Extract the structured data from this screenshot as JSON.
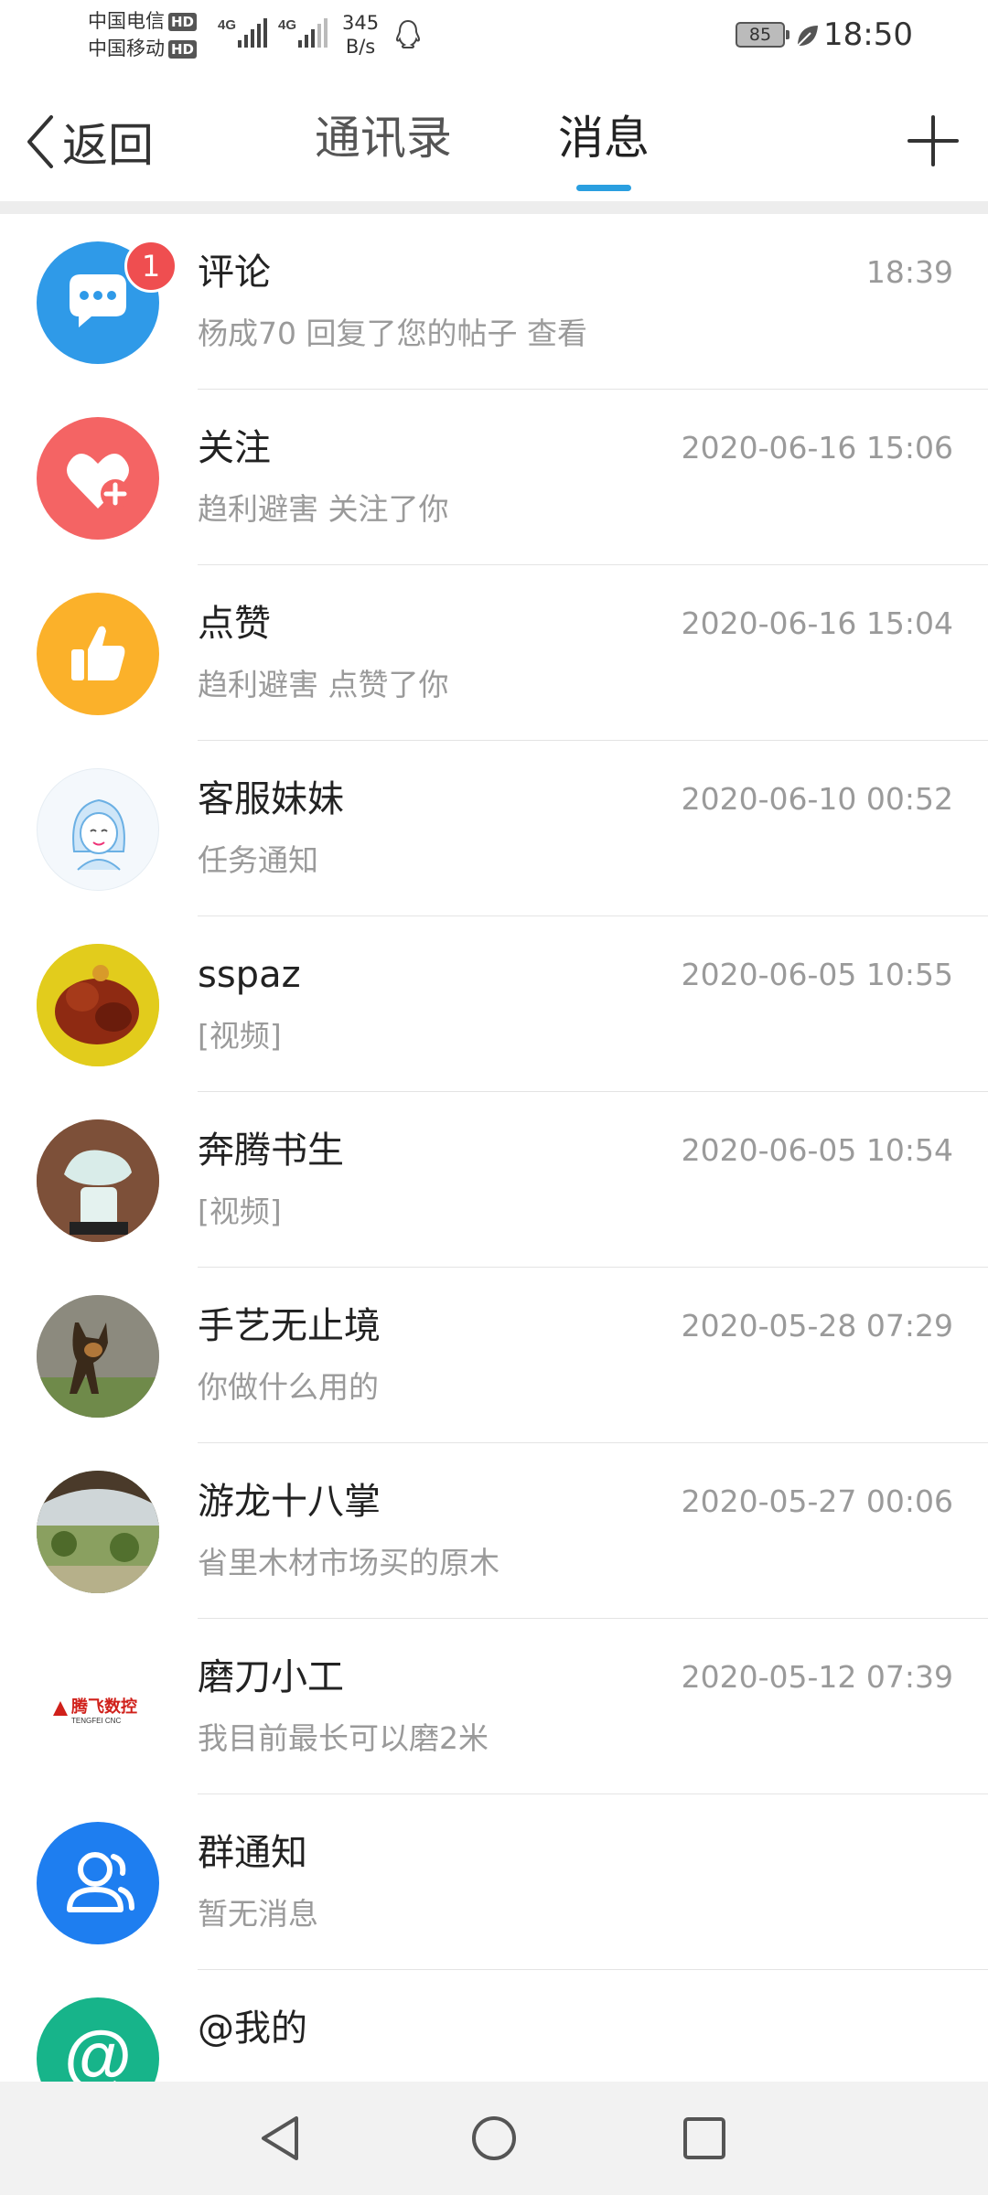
{
  "status_bar": {
    "carrier1": "中国电信",
    "carrier2": "中国移动",
    "hd": "HD",
    "net1": "4G",
    "net2": "4G",
    "speed_value": "345",
    "speed_unit": "B/s",
    "battery": "85",
    "time": "18:50"
  },
  "header": {
    "back_label": "返回",
    "tabs": [
      {
        "label": "通讯录",
        "active": false
      },
      {
        "label": "消息",
        "active": true
      }
    ],
    "accent_color": "#2a9fe0"
  },
  "messages": [
    {
      "title": "评论",
      "time": "18:39",
      "subtitle": "杨成70 回复了您的帖子   查看",
      "badge": "1",
      "avatar": "comment-icon",
      "color": "#2f9ae8"
    },
    {
      "title": "关注",
      "time": "2020-06-16 15:06",
      "subtitle": "趋利避害 关注了你",
      "avatar": "heart-plus-icon",
      "color": "#f46464"
    },
    {
      "title": "点赞",
      "time": "2020-06-16 15:04",
      "subtitle": "趋利避害 点赞了你",
      "avatar": "thumbs-up-icon",
      "color": "#fbb12a"
    },
    {
      "title": "客服妹妹",
      "time": "2020-06-10 00:52",
      "subtitle": "任务通知",
      "avatar": "customer-service-avatar"
    },
    {
      "title": "sspaz",
      "time": "2020-06-05 10:55",
      "subtitle": "[视频]",
      "avatar": "carving-photo-avatar"
    },
    {
      "title": "奔腾书生",
      "time": "2020-06-05 10:54",
      "subtitle": "[视频]",
      "avatar": "jade-carving-avatar"
    },
    {
      "title": "手艺无止境",
      "time": "2020-05-28 07:29",
      "subtitle": "你做什么用的",
      "avatar": "dog-photo-avatar"
    },
    {
      "title": "游龙十八掌",
      "time": "2020-05-27 00:06",
      "subtitle": "省里木材市场买的原木",
      "avatar": "landscape-photo-avatar"
    },
    {
      "title": "磨刀小工",
      "time": "2020-05-12 07:39",
      "subtitle": "我目前最长可以磨2米",
      "avatar": "tengfei-cnc-logo-avatar",
      "logo_text": "腾飞数控",
      "logo_sub": "TENGFEI CNC"
    },
    {
      "title": "群通知",
      "time": "",
      "subtitle": "暂无消息",
      "avatar": "group-icon",
      "color": "#1e7ef0"
    },
    {
      "title": "@我的",
      "time": "",
      "subtitle": "",
      "avatar": "at-icon",
      "color": "#17b48a"
    }
  ]
}
